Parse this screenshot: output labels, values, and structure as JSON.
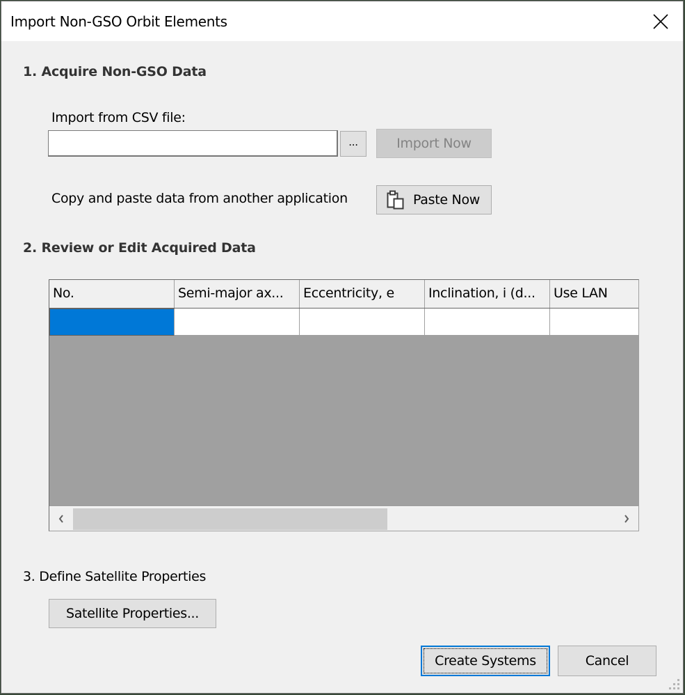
{
  "window": {
    "title": "Import Non-GSO Orbit Elements",
    "close_icon": "close-icon"
  },
  "section1": {
    "title": "1. Acquire Non-GSO Data",
    "csv_label": "Import from CSV file:",
    "csv_path_value": "",
    "browse_label": "...",
    "import_now_label": "Import Now",
    "import_now_enabled": false,
    "paste_label": "Copy and paste data from another application",
    "paste_now_label": "Paste Now",
    "paste_icon": "clipboard-paste-icon"
  },
  "section2": {
    "title": "2. Review or Edit Acquired Data",
    "grid": {
      "columns": [
        {
          "label": "No."
        },
        {
          "label": "Semi-major ax..."
        },
        {
          "label": "Eccentricity, e"
        },
        {
          "label": "Inclination, i (d..."
        },
        {
          "label": "Use LAN"
        }
      ],
      "rows": [
        {
          "cells": [
            "",
            "",
            "",
            "",
            ""
          ],
          "selected_cell": 0
        }
      ],
      "scrollbar": {
        "left_arrow": "chevron-left-icon",
        "right_arrow": "chevron-right-icon",
        "position_fraction": 0.0,
        "visible_fraction": 0.58
      }
    }
  },
  "section3": {
    "title": "3. Define Satellite Properties",
    "satellite_properties_label": "Satellite Properties..."
  },
  "footer": {
    "create_label": "Create Systems",
    "cancel_label": "Cancel"
  },
  "colors": {
    "selection": "#0078d7",
    "grid_background": "#a0a0a0",
    "dialog_background": "#f0f0f0"
  }
}
